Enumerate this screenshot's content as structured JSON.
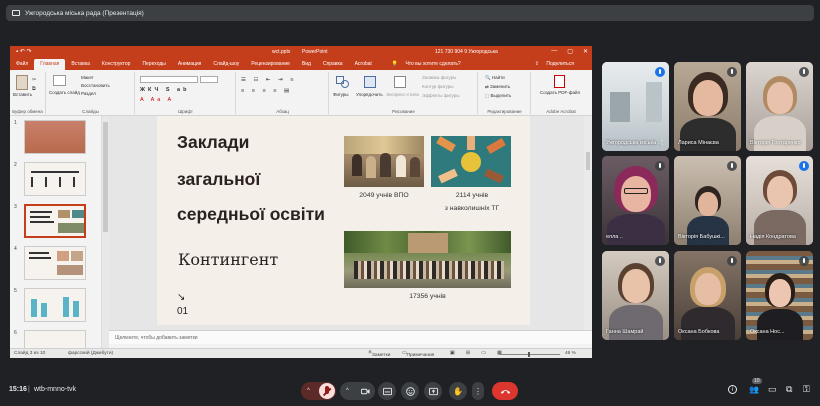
{
  "meeting": {
    "presenting_label": "Ужгородська міська рада (Презентація)",
    "time": "15:16",
    "separator": "|",
    "code": "wtb-mnno-tvk",
    "participants_count": "10"
  },
  "ppt": {
    "doc_name": "wct.pptx",
    "app_name": "PowerPoint",
    "number_field": "121 730 904 9 Ужгородська",
    "tabs": [
      "Файл",
      "Главная",
      "Вставка",
      "Конструктор",
      "Переходы",
      "Анимация",
      "Слайд-шоу",
      "Рецензирование",
      "Вид",
      "Справка",
      "Acrobat"
    ],
    "active_tab": 1,
    "tell_me": "Что вы хотите сделать?",
    "share": "Поделиться",
    "ribbon": {
      "paste": "Вставить",
      "clipboard": "Буфер обмена",
      "new_slide": "Создать слайд",
      "layout": "Макет",
      "reset": "Восстановить",
      "section": "Раздел",
      "slides": "Слайды",
      "font": "Шрифт",
      "paragraph": "Абзац",
      "shapes": "Фигуры",
      "arrange": "Упорядочить",
      "quick_styles": "Экспресс-стили",
      "shape_fill": "Заливка фигуры",
      "shape_outline": "Контур фигуры",
      "shape_effects": "Эффекты фигуры",
      "drawing": "Рисование",
      "find": "Найти",
      "replace": "Заменить",
      "select": "Выделить",
      "editing": "Редактирование",
      "create_pdf": "Создать PDF-файл",
      "adobe": "Adobe Acrobat"
    },
    "thumb_numbers": [
      "1",
      "2",
      "3",
      "4",
      "5",
      "6"
    ],
    "notes_placeholder": "Щелкните, чтобы добавить заметки",
    "status": {
      "slide_info": "Слайд 3 из 10",
      "language": "фарсский (Джибути)",
      "notes": "Заметки",
      "comments": "Примечания",
      "zoom": "46 %"
    },
    "slide": {
      "title_lines": [
        "Заклади",
        "загальної",
        "середньої освіти"
      ],
      "subtitle": "Контингент",
      "caption1": "2049 учнів ВПО",
      "caption2_lines": [
        "2114 учнів",
        "з навколишніх ТГ"
      ],
      "caption3": "17356 учнів",
      "marker_arrow": "↘",
      "marker_num": "01"
    }
  },
  "participants": [
    {
      "name": "Ужгородська міська ...",
      "bg": "#cfd6da"
    },
    {
      "name": "Лариса Мінаєва",
      "bg": "#9a8a7a"
    },
    {
      "name": "Вікторія Гонтаренко",
      "bg": "#bdb6b0"
    },
    {
      "name": "елла ..",
      "bg": "#7b6b70"
    },
    {
      "name": "Вікторія Бабушкі...",
      "bg": "#a99b8c"
    },
    {
      "name": "Надія Кондратова",
      "bg": "#c9c1bb"
    },
    {
      "name": "Ганна Шамрай",
      "bg": "#b4aa9e"
    },
    {
      "name": "Оксана Бобкова",
      "bg": "#6b5d54"
    },
    {
      "name": "Оксана Нос...",
      "bg": "#8a7d70"
    }
  ]
}
